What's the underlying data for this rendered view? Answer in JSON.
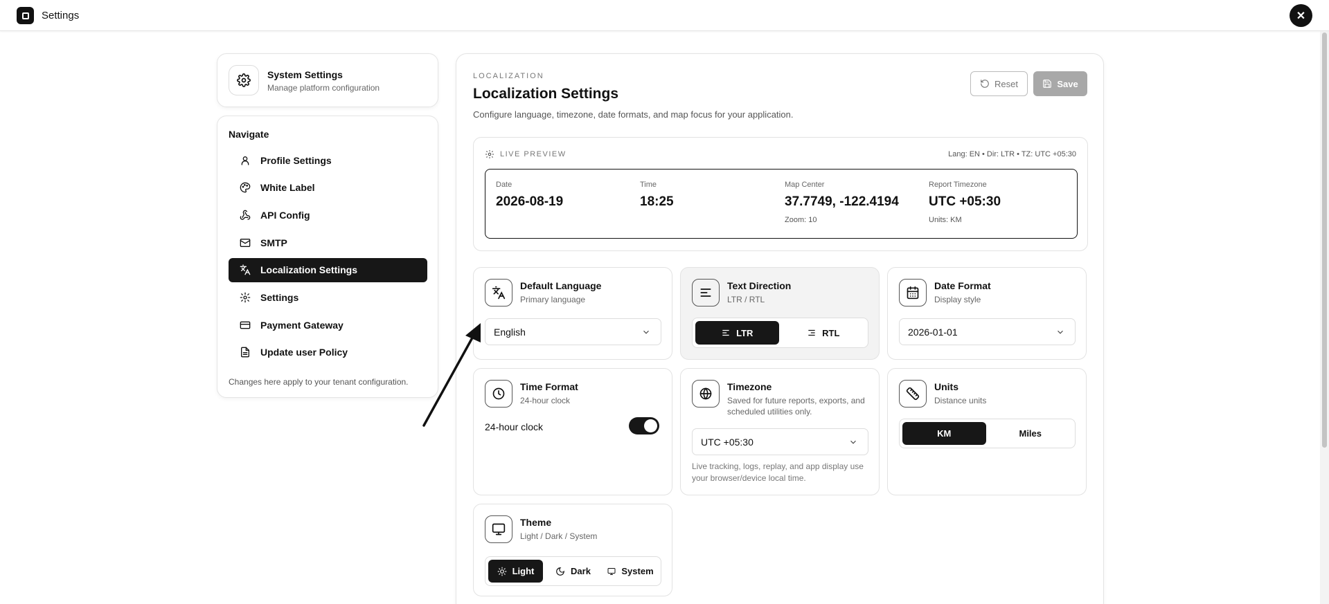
{
  "app": {
    "title": "Settings"
  },
  "sidebar": {
    "system_card": {
      "title": "System Settings",
      "subtitle": "Manage platform configuration"
    },
    "nav_heading": "Navigate",
    "items": [
      {
        "label": "Profile Settings",
        "icon": "user-icon"
      },
      {
        "label": "White Label",
        "icon": "palette-icon"
      },
      {
        "label": "API Config",
        "icon": "webhook-icon"
      },
      {
        "label": "SMTP",
        "icon": "mail-icon"
      },
      {
        "label": "Localization Settings",
        "icon": "languages-icon",
        "active": true
      },
      {
        "label": "Settings",
        "icon": "gear-icon"
      },
      {
        "label": "Payment Gateway",
        "icon": "credit-card-icon"
      },
      {
        "label": "Update user Policy",
        "icon": "file-icon"
      }
    ],
    "footer": "Changes here apply to your tenant configuration."
  },
  "main": {
    "eyebrow": "LOCALIZATION",
    "title": "Localization Settings",
    "description": "Configure language, timezone, date formats, and map focus for your application.",
    "reset_label": "Reset",
    "save_label": "Save",
    "preview": {
      "label": "LIVE PREVIEW",
      "meta": "Lang: EN • Dir: LTR • TZ: UTC +05:30",
      "date_label": "Date",
      "date_value": "2026-08-19",
      "time_label": "Time",
      "time_value": "18:25",
      "map_label": "Map Center",
      "map_value": "37.7749, -122.4194",
      "map_zoom": "Zoom: 10",
      "tz_label": "Report Timezone",
      "tz_value": "UTC +05:30",
      "tz_units": "Units: KM"
    },
    "language": {
      "title": "Default Language",
      "subtitle": "Primary language",
      "value": "English"
    },
    "direction": {
      "title": "Text Direction",
      "subtitle": "LTR / RTL",
      "ltr": "LTR",
      "rtl": "RTL",
      "selected": "LTR"
    },
    "date_format": {
      "title": "Date Format",
      "subtitle": "Display style",
      "value": "2026-01-01"
    },
    "time_format": {
      "title": "Time Format",
      "subtitle": "24-hour clock",
      "toggle_label": "24-hour clock",
      "enabled": true
    },
    "timezone": {
      "title": "Timezone",
      "subtitle": "Saved for future reports, exports, and scheduled utilities only.",
      "value": "UTC +05:30",
      "note": "Live tracking, logs, replay, and app display use your browser/device local time."
    },
    "units": {
      "title": "Units",
      "subtitle": "Distance units",
      "km": "KM",
      "miles": "Miles",
      "selected": "KM"
    },
    "theme": {
      "title": "Theme",
      "subtitle": "Light / Dark / System",
      "light": "Light",
      "dark": "Dark",
      "system": "System",
      "selected": "Light"
    }
  }
}
